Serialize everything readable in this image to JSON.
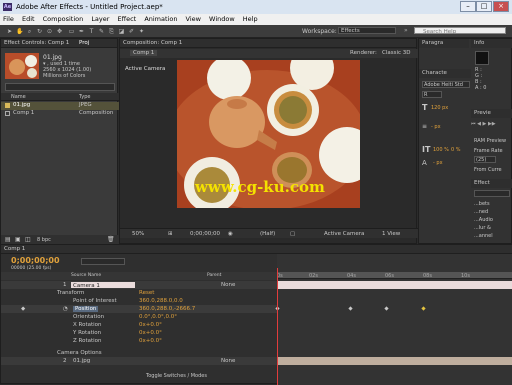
{
  "window": {
    "title": "Adobe After Effects - Untitled Project.aep*",
    "app_abbr": "Ae"
  },
  "menu": [
    "File",
    "Edit",
    "Composition",
    "Layer",
    "Effect",
    "Animation",
    "View",
    "Window",
    "Help"
  ],
  "toolbar": {
    "workspace_label": "Workspace:",
    "workspace_value": "Effects",
    "search_placeholder": "Search Help"
  },
  "project": {
    "tab_effect_controls": "Effect Controls: Comp 1",
    "tab_project": "Proj",
    "thumb_name": "01.jpg",
    "thumb_info1": "▾ , used 1 time",
    "thumb_info2": "2560 x 1024 (1.00)",
    "thumb_info3": "Millions of Colors",
    "col_name": "Name",
    "col_type": "Type",
    "items": [
      {
        "name": "01.jpg",
        "type": "JPEG"
      },
      {
        "name": "Comp 1",
        "type": "Composition"
      }
    ],
    "bpc": "8 bpc"
  },
  "comp": {
    "tab": "Composition: Comp 1",
    "subtab": "Comp 1",
    "renderer_label": "Renderer:",
    "renderer_value": "Classic 3D",
    "view_label": "Active Camera",
    "zoom": "50%",
    "timecode": "0;00;00;00",
    "resolution": "(Half)",
    "camera": "Active Camera",
    "views": "1 View",
    "watermark": "www.cg-ku.com"
  },
  "right": {
    "paragraph": "Paragra",
    "info": "Info",
    "rgba": [
      "R :",
      "G :",
      "B :",
      "A : 0"
    ],
    "character": "Characte",
    "font": "Adobe Heiti Std",
    "font_style": "R",
    "size1": "120 px",
    "size2": "- px",
    "scale1": "100 %",
    "scale2": "0 %",
    "px3": "- px",
    "preview": "Previe",
    "ram_preview": "RAM Preview",
    "frame_rate_label": "Frame Rate",
    "frame_rate_value": "(25)",
    "from_current": "From Curre",
    "effects": "Effect",
    "effects_items": [
      "...bets",
      "...ned",
      "...Audio",
      "...lur &",
      "...annel"
    ]
  },
  "timeline": {
    "tab": "Comp 1",
    "timecode": "0;00;00;00",
    "fps": "00000 (25.00 fps)",
    "col_source": "Source Name",
    "col_parent": "Parent",
    "ruler": [
      "0s",
      "02s",
      "04s",
      "06s",
      "08s",
      "10s"
    ],
    "layers": [
      {
        "num": "1",
        "name": "Camera 1",
        "parent": "None"
      },
      {
        "num": "2",
        "name": "01.jpg",
        "parent": "None"
      }
    ],
    "transform_label": "Transform",
    "reset": "Reset",
    "props": [
      {
        "name": "Point of Interest",
        "value": "360.0,288.0,0.0"
      },
      {
        "name": "Position",
        "value": "360.0,288.0,-2666.7"
      },
      {
        "name": "Orientation",
        "value": "0.0°,0.0°,0.0°"
      },
      {
        "name": "X Rotation",
        "value": "0x+0.0°"
      },
      {
        "name": "Y Rotation",
        "value": "0x+0.0°"
      },
      {
        "name": "Z Rotation",
        "value": "0x+0.0°"
      }
    ],
    "camera_options": "Camera Options",
    "toggle": "Toggle Switches / Modes"
  }
}
